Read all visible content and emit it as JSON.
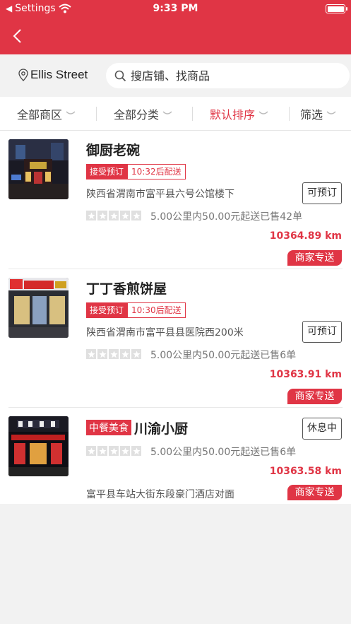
{
  "status_bar": {
    "carrier": "Settings",
    "time": "9:33 PM"
  },
  "location": "Ellis Street",
  "search": {
    "placeholder": "搜店铺、找商品"
  },
  "filters": [
    {
      "label": "全部商区"
    },
    {
      "label": "全部分类"
    },
    {
      "label": "默认排序"
    },
    {
      "label": "筛选"
    }
  ],
  "shops": [
    {
      "name": "御厨老碗",
      "tag_accept": "接受预订",
      "tag_time": "10:32后配送",
      "address": "陕西省渭南市富平县六号公馆楼下",
      "status": "可预订",
      "meta": "5.00公里内50.00元起送已售42单",
      "rating": 0,
      "distance": "10364.89 km",
      "delivery": "商家专送"
    },
    {
      "name": "丁丁香煎饼屋",
      "tag_accept": "接受预订",
      "tag_time": "10:30后配送",
      "address": "陕西省渭南市富平县县医院西200米",
      "status": "可预订",
      "meta": "5.00公里内50.00元起送已售6单",
      "rating": 0,
      "distance": "10363.91 km",
      "delivery": "商家专送"
    },
    {
      "category": "中餐美食",
      "name": "川渝小厨",
      "status": "休息中",
      "meta": "5.00公里内50.00元起送已售6单",
      "rating": 0,
      "distance": "10363.58 km",
      "address": "富平县车站大街东段豪门酒店对面",
      "delivery": "商家专送"
    }
  ],
  "colors": {
    "brand": "#e03545",
    "background": "#f2f2f2"
  }
}
